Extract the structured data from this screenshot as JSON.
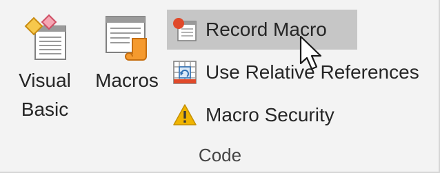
{
  "ribbon": {
    "visual_basic": {
      "line1": "Visual",
      "line2": "Basic",
      "icon": "visual-basic-icon"
    },
    "macros": {
      "label": "Macros",
      "icon": "macros-icon"
    },
    "record_macro": {
      "label": "Record Macro",
      "icon": "record-macro-icon",
      "state": "hover"
    },
    "relative_refs": {
      "label": "Use Relative References",
      "icon": "relative-references-icon"
    },
    "macro_security": {
      "label": "Macro Security",
      "icon": "warning-icon"
    },
    "group_label": "Code"
  },
  "colors": {
    "hover_bg": "#c6c6c6",
    "record_dot": "#e0492a",
    "warning": "#f0b400",
    "scroll_orange": "#f59a2e"
  }
}
